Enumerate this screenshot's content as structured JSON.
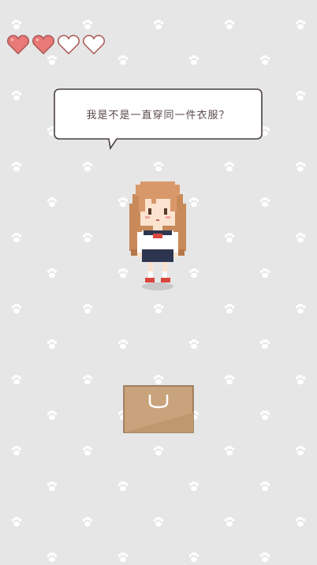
{
  "hud": {
    "hearts": [
      {
        "state": "full",
        "icon": "heart-full-icon"
      },
      {
        "state": "full",
        "icon": "heart-full-icon"
      },
      {
        "state": "empty",
        "icon": "heart-empty-icon"
      },
      {
        "state": "empty",
        "icon": "heart-empty-icon"
      }
    ],
    "hearts_filled": 2,
    "hearts_total": 4
  },
  "dialogue": {
    "text": "我是不是一直穿同一件衣服？"
  },
  "colors": {
    "background": "#e6e6e6",
    "paw_print": "#ffffff",
    "heart_fill": "#e97a78",
    "heart_outline": "#a85555",
    "bubble_border": "#4a4040",
    "bag": "#c9a37b"
  },
  "icons": {
    "bag": "shopping-bag-icon",
    "background": "paw-print-icon"
  }
}
